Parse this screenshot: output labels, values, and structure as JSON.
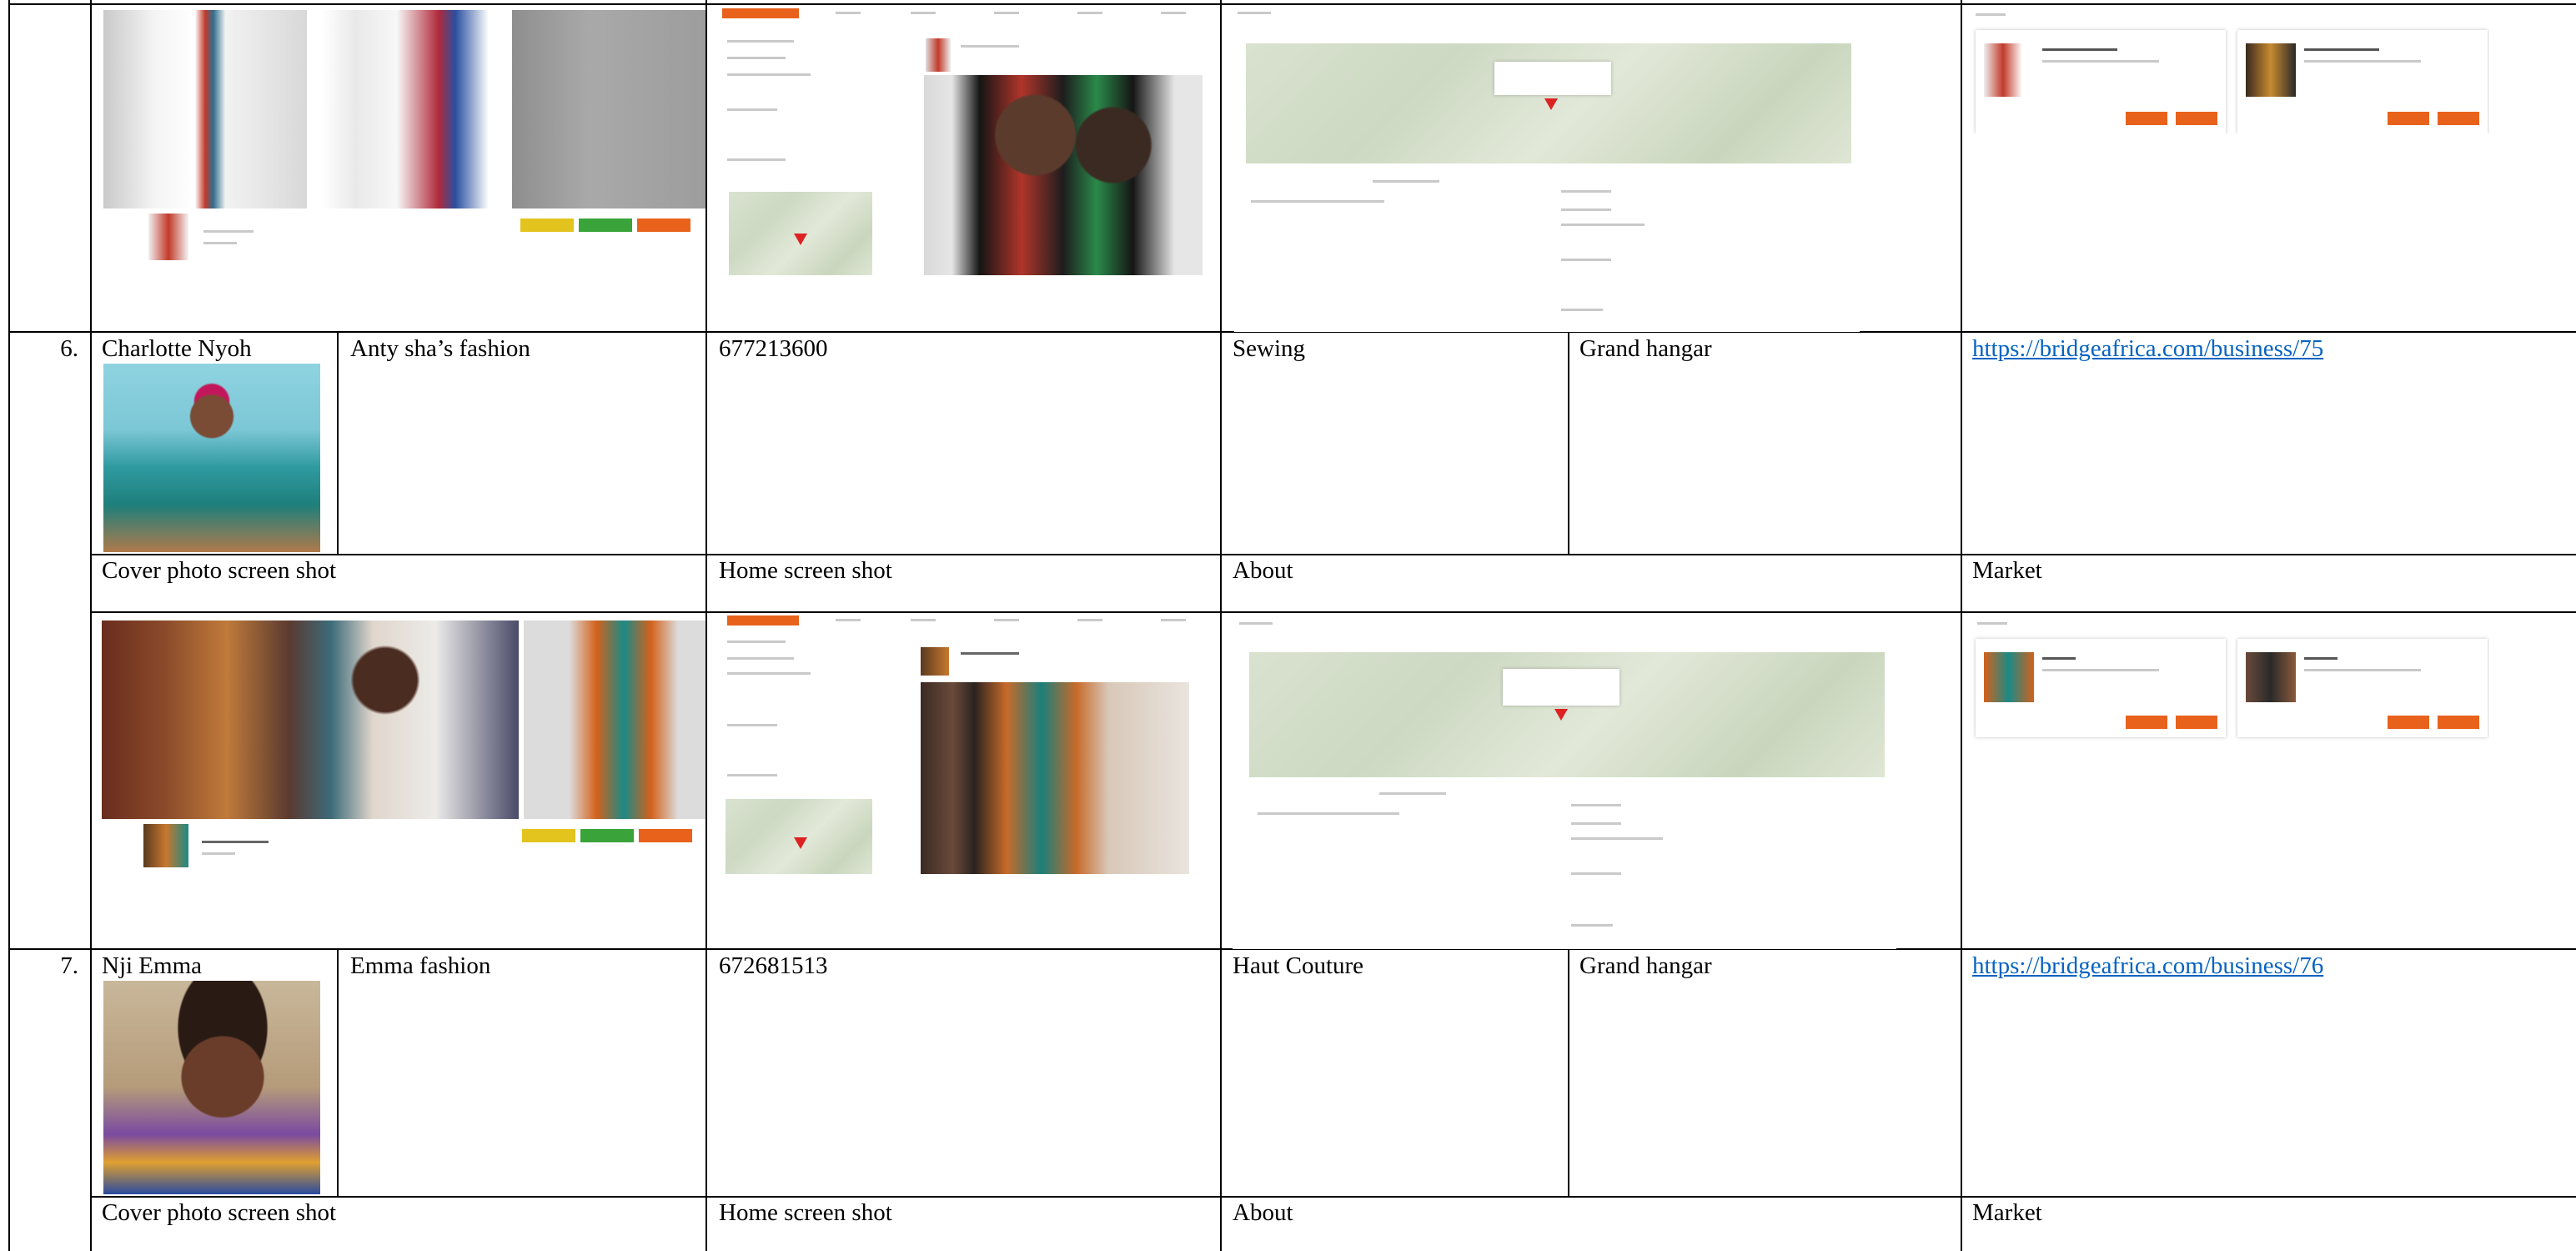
{
  "columns": {
    "cover": "Cover photo screen shot",
    "home": "Home screen shot",
    "about": "About",
    "market": "Market"
  },
  "rows": [
    {
      "number": "6.",
      "name": "Charlotte Nyoh",
      "business": "Anty sha’s fashion",
      "phone": "677213600",
      "category": "Sewing",
      "location": "Grand hangar",
      "url": "https://bridgeafrica.com/business/75"
    },
    {
      "number": "7.",
      "name": "Nji Emma",
      "business": "Emma fashion",
      "phone": "672681513",
      "category": "Haut Couture",
      "location": "Grand hangar",
      "url": "https://bridgeafrica.com/business/76"
    }
  ],
  "colors": {
    "link": "#0563c1",
    "accent_orange": "#e8621c",
    "accent_green": "#3aa33a",
    "accent_yellow": "#e3c31e"
  }
}
